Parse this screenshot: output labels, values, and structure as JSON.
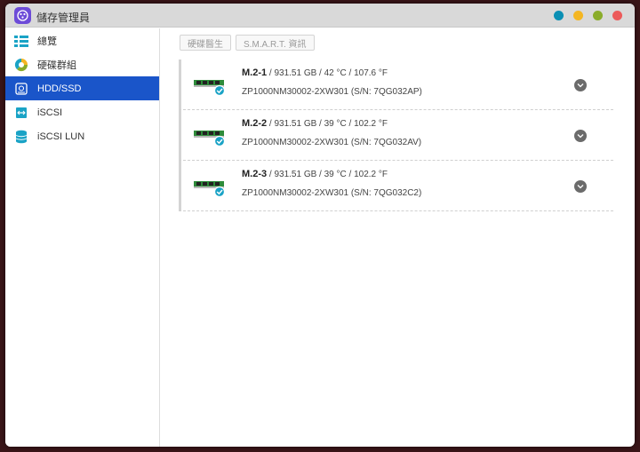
{
  "window": {
    "title": "儲存管理員"
  },
  "titlebar_dots": [
    "#0a8fb4",
    "#f4b622",
    "#8aac2a",
    "#ec5a5a"
  ],
  "sidebar": {
    "items": [
      {
        "label": "總覽",
        "icon": "overview-icon"
      },
      {
        "label": "硬碟群組",
        "icon": "disk-group-icon"
      },
      {
        "label": "HDD/SSD",
        "icon": "hdd-ssd-icon",
        "active": true
      },
      {
        "label": "iSCSI",
        "icon": "iscsi-icon"
      },
      {
        "label": "iSCSI LUN",
        "icon": "iscsi-lun-icon"
      }
    ]
  },
  "toolbar": {
    "health_label": "硬碟醫生",
    "smart_label": "S.M.A.R.T. 資訊"
  },
  "disks": [
    {
      "name": "M.2-1",
      "details": " / 931.51 GB / 42 °C / 107.6 °F",
      "model": "ZP1000NM30002-2XW301 (S/N: 7QG032AP)"
    },
    {
      "name": "M.2-2",
      "details": " / 931.51 GB / 39 °C / 102.2 °F",
      "model": "ZP1000NM30002-2XW301 (S/N: 7QG032AV)"
    },
    {
      "name": "M.2-3",
      "details": " / 931.51 GB / 39 °C / 102.2 °F",
      "model": "ZP1000NM30002-2XW301 (S/N: 7QG032C2)"
    }
  ]
}
